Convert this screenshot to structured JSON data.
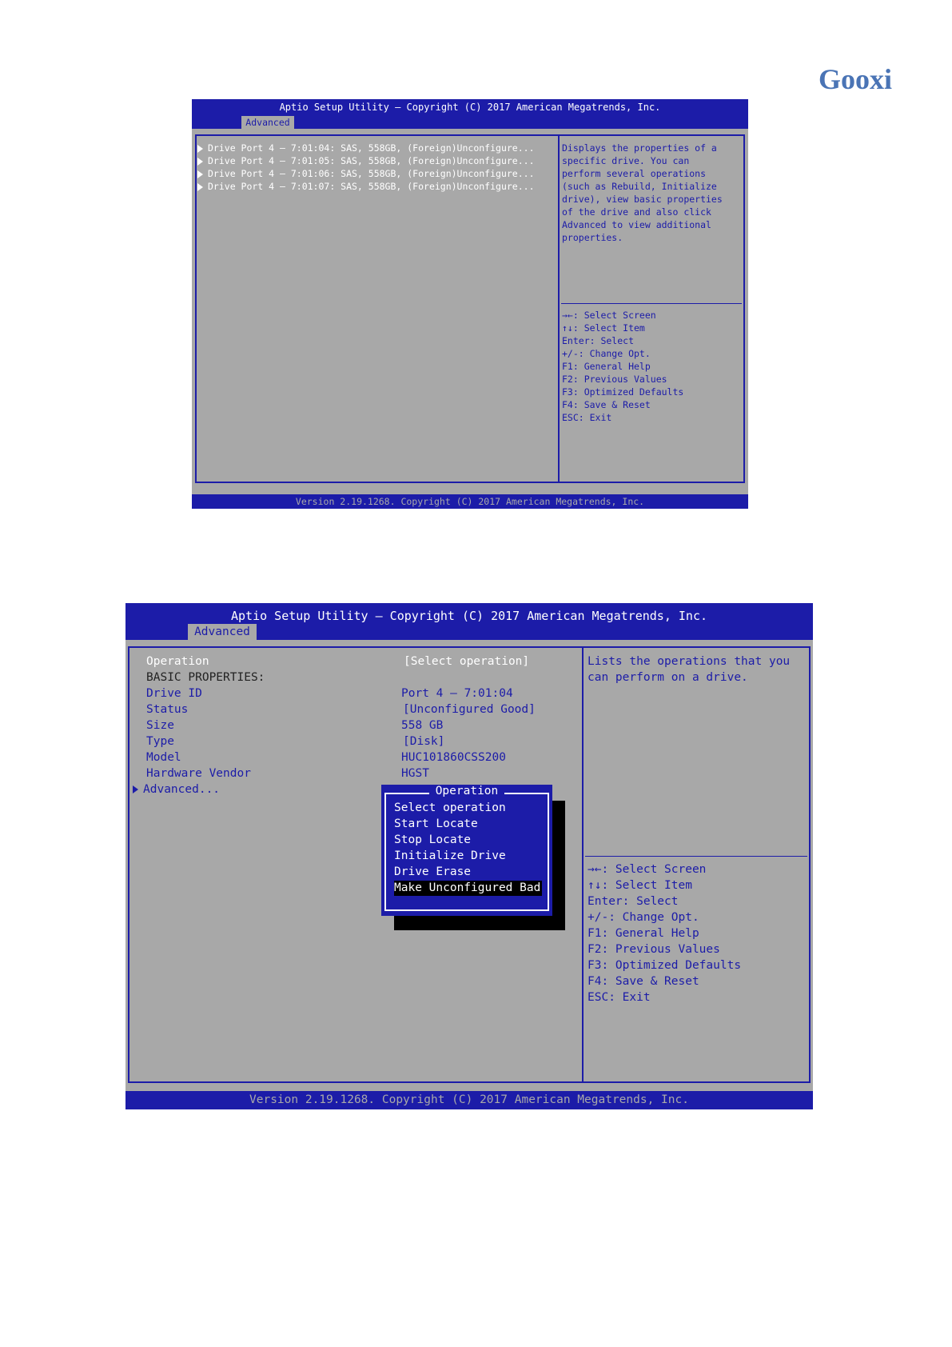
{
  "brand": {
    "logo_text": "Gooxi"
  },
  "colors": {
    "bios_blue": "#1c1ca8",
    "bios_gray": "#a8a8a8",
    "logo_blue": "#4a74b5"
  },
  "screen1": {
    "title": "Aptio Setup Utility – Copyright (C) 2017 American Megatrends, Inc.",
    "tab": "Advanced",
    "drives": [
      "Drive Port 4 – 7:01:04: SAS, 558GB, (Foreign)Unconfigure...",
      "Drive Port 4 – 7:01:05: SAS, 558GB, (Foreign)Unconfigure...",
      "Drive Port 4 – 7:01:06: SAS, 558GB, (Foreign)Unconfigure...",
      "Drive Port 4 – 7:01:07: SAS, 558GB, (Foreign)Unconfigure..."
    ],
    "help_text": [
      "Displays the properties of a",
      "specific drive. You can",
      "perform several operations",
      "(such as Rebuild, Initialize",
      "drive), view basic properties",
      "of the drive and also click",
      "Advanced to view additional",
      "properties."
    ],
    "keys": [
      "→←: Select Screen",
      "↑↓: Select Item",
      "Enter: Select",
      "+/-: Change Opt.",
      "F1: General Help",
      "F2: Previous Values",
      "F3: Optimized Defaults",
      "F4: Save & Reset",
      "ESC: Exit"
    ],
    "footer": "Version 2.19.1268. Copyright (C) 2017 American Megatrends, Inc."
  },
  "screen2": {
    "title": "Aptio Setup Utility – Copyright (C) 2017 American Megatrends, Inc.",
    "tab": "Advanced",
    "rows": [
      {
        "label": "Operation",
        "value": "[Select operation]"
      },
      {
        "label": "BASIC PROPERTIES:",
        "value": ""
      },
      {
        "label": "Drive ID",
        "value": "Port 4 – 7:01:04"
      },
      {
        "label": "Status",
        "value": "[Unconfigured Good]"
      },
      {
        "label": "Size",
        "value": "558 GB"
      },
      {
        "label": "Type",
        "value": "[Disk]"
      },
      {
        "label": "Model",
        "value": "HUC101860CSS200"
      },
      {
        "label": "Hardware Vendor",
        "value": "HGST"
      }
    ],
    "advanced_link": "Advanced...",
    "help_text": [
      "Lists the operations that you",
      "can perform on a drive."
    ],
    "keys": [
      "→←: Select Screen",
      "↑↓: Select Item",
      "Enter: Select",
      "+/-: Change Opt.",
      "F1: General Help",
      "F2: Previous Values",
      "F3: Optimized Defaults",
      "F4: Save & Reset",
      "ESC: Exit"
    ],
    "popup": {
      "title": "Operation",
      "options": [
        "Select operation",
        "Start Locate",
        "Stop Locate",
        "Initialize Drive",
        "Drive Erase",
        "Make Unconfigured Bad"
      ],
      "selected": "Make Unconfigured Bad"
    },
    "footer": "Version 2.19.1268. Copyright (C) 2017 American Megatrends, Inc."
  }
}
